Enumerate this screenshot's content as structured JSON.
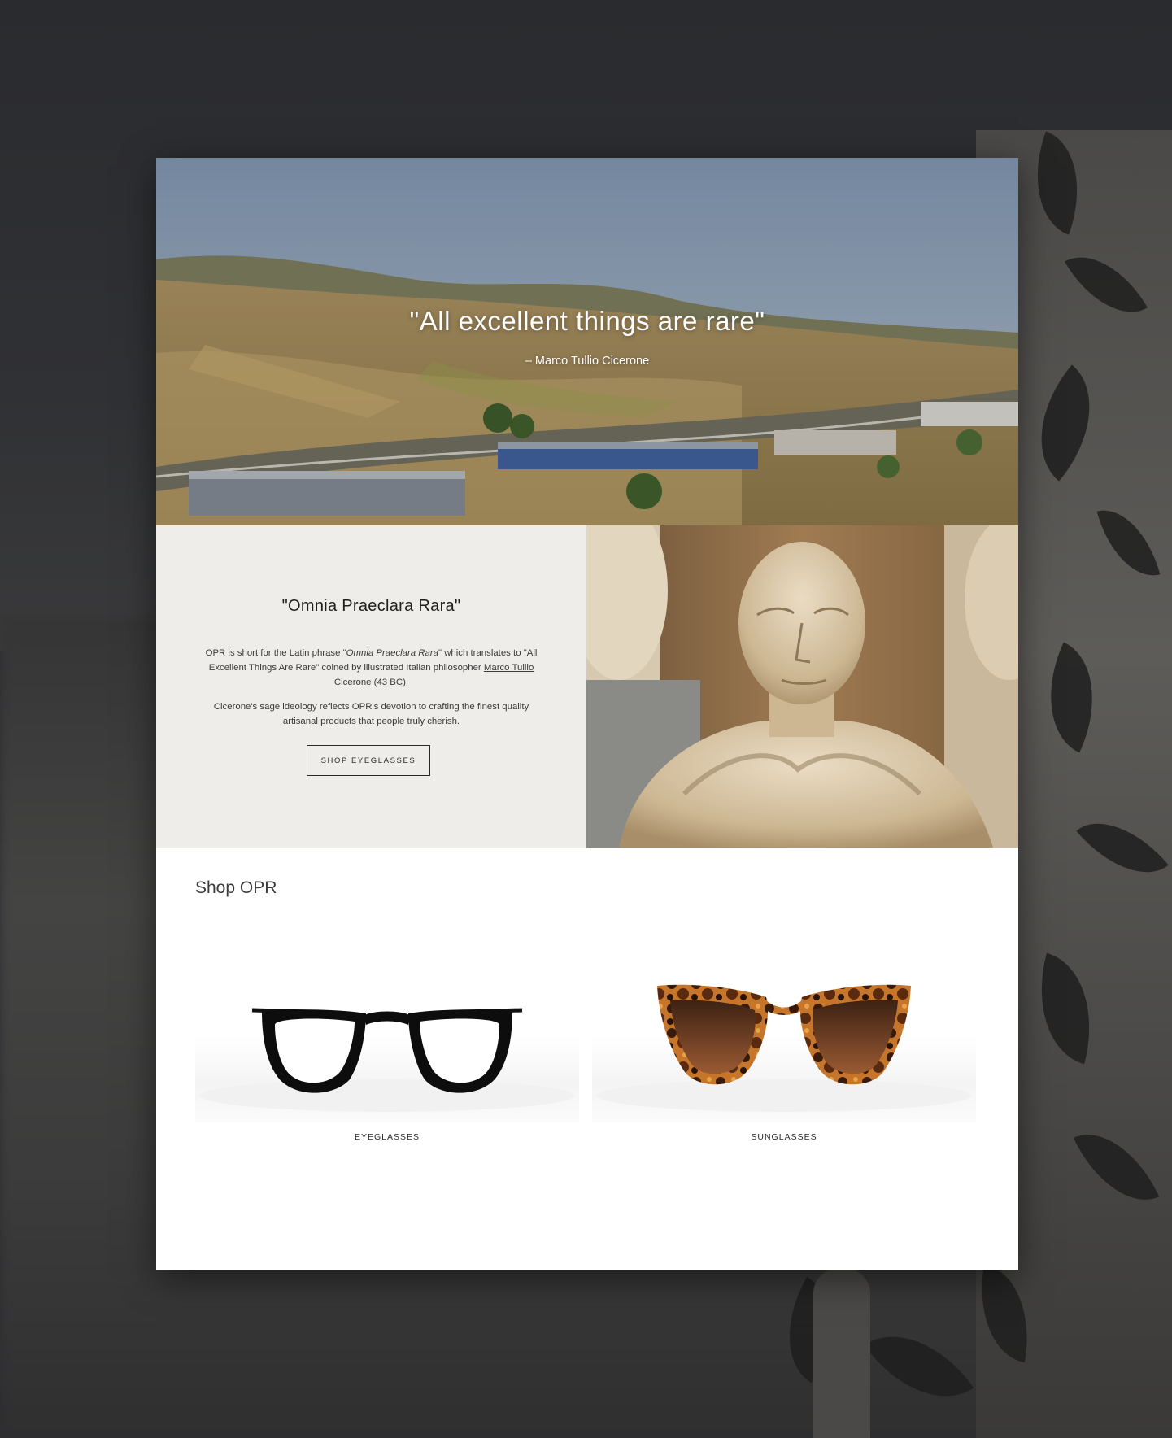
{
  "hero": {
    "quote": "\"All excellent things are rare\"",
    "attribution": "– Marco Tullio Cicerone"
  },
  "about": {
    "title": "\"Omnia Praeclara Rara\"",
    "p1_before": "OPR is short for the Latin phrase \"",
    "p1_italic": "Omnia Praeclara Rara",
    "p1_middle": "\" which translates to \"All Excellent Things Are Rare\" coined by illustrated Italian philosopher ",
    "p1_link": "Marco Tullio Cicerone",
    "p1_after": " (43 BC).",
    "p2": "Cicerone's sage ideology reflects OPR's devotion to crafting the finest quality artisanal products that people truly cherish.",
    "button_label": "SHOP EYEGLASSES"
  },
  "shop": {
    "title": "Shop OPR",
    "products": [
      {
        "label": "EYEGLASSES"
      },
      {
        "label": "SUNGLASSES"
      }
    ]
  },
  "colors": {
    "backdrop": "#2c2d30",
    "about_bg": "#efede9",
    "text_dark": "#1e1e1e"
  }
}
